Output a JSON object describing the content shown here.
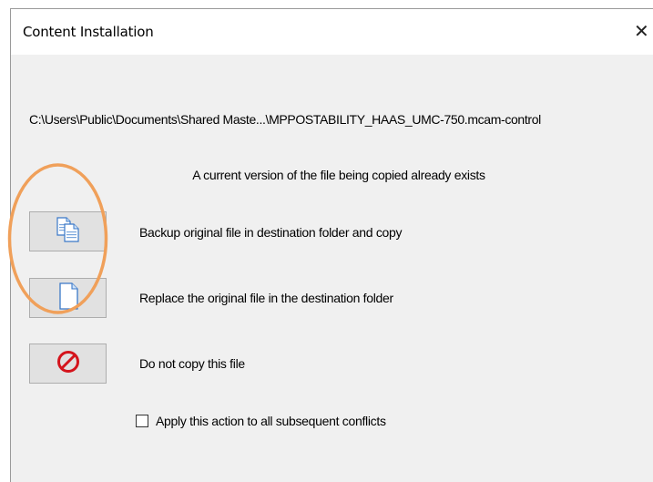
{
  "dialog": {
    "title": "Content Installation",
    "close_glyph": "✕",
    "file_path": "C:\\Users\\Public\\Documents\\Shared Maste...\\MPPOSTABILITY_HAAS_UMC-750.mcam-control",
    "message": "A current version of the file being copied already exists"
  },
  "options": [
    {
      "icon": "copy-files-icon",
      "label": "Backup original file in destination folder and copy"
    },
    {
      "icon": "document-icon",
      "label": "Replace the original file in the destination folder"
    },
    {
      "icon": "no-entry-icon",
      "label": "Do not copy this file"
    }
  ],
  "apply_all": {
    "label": "Apply this action to all subsequent conflicts",
    "checked": false
  },
  "colors": {
    "dialog_bg": "#f0f0f0",
    "button_bg": "#e1e1e1",
    "annotation_ring": "#f0a05a",
    "prohibit_red": "#d4141c",
    "doc_blue": "#3a78c8"
  }
}
